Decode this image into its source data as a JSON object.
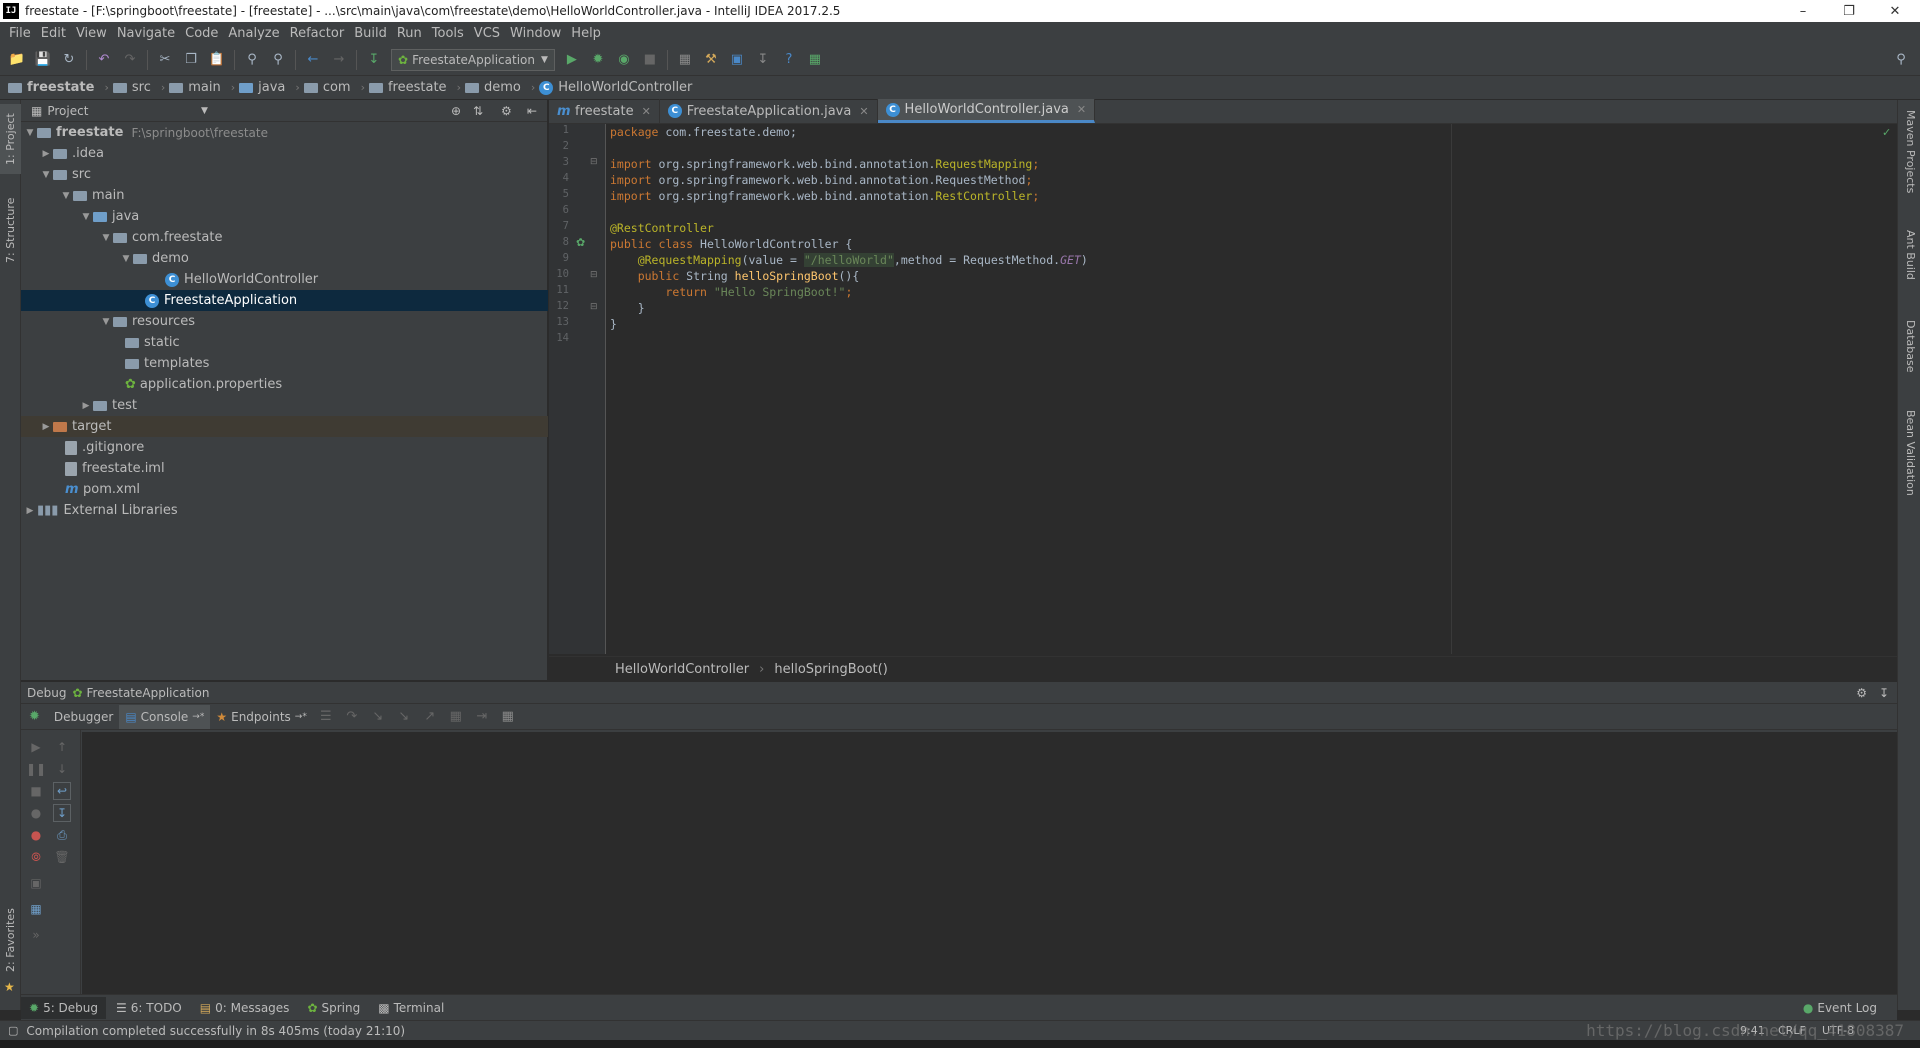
{
  "window": {
    "title": "freestate - [F:\\springboot\\freestate] - [freestate] - ...\\src\\main\\java\\com\\freestate\\demo\\HelloWorldController.java - IntelliJ IDEA 2017.2.5",
    "logo": "IJ"
  },
  "menu": [
    "File",
    "Edit",
    "View",
    "Navigate",
    "Code",
    "Analyze",
    "Refactor",
    "Build",
    "Run",
    "Tools",
    "VCS",
    "Window",
    "Help"
  ],
  "toolbar": {
    "run_config": "FreestateApplication"
  },
  "breadcrumb": [
    "freestate",
    "src",
    "main",
    "java",
    "com",
    "freestate",
    "demo",
    "HelloWorldController"
  ],
  "left_tabs": {
    "project": "1: Project",
    "structure": "7: Structure",
    "favorites": "2: Favorites"
  },
  "right_tabs": {
    "maven": "Maven Projects",
    "ant": "Ant Build",
    "database": "Database",
    "bean": "Bean Validation"
  },
  "project": {
    "header": "Project",
    "root_name": "freestate",
    "root_path": "F:\\springboot\\freestate",
    "nodes": {
      "idea": ".idea",
      "src": "src",
      "main": "main",
      "java": "java",
      "pkg": "com.freestate",
      "demo": "demo",
      "controller": "HelloWorldController",
      "app": "FreestateApplication",
      "resources": "resources",
      "static": "static",
      "templates": "templates",
      "props": "application.properties",
      "test": "test",
      "target": "target",
      "gitignore": ".gitignore",
      "iml": "freestate.iml",
      "pom": "pom.xml",
      "extlib": "External Libraries"
    }
  },
  "editor_tabs": [
    {
      "label": "freestate"
    },
    {
      "label": "FreestateApplication.java"
    },
    {
      "label": "HelloWorldController.java"
    }
  ],
  "code": {
    "line_numbers": [
      "1",
      "2",
      "3",
      "4",
      "5",
      "6",
      "7",
      "8",
      "9",
      "10",
      "11",
      "12",
      "13",
      "14"
    ],
    "l1_kw": "package",
    "l1_rest": " com.freestate.demo;",
    "imp": "import",
    "l3_pkg": " org.springframework.web.bind.annotation.",
    "l3_cls": "RequestMapping",
    "l4_pkg": " org.springframework.web.bind.annotation.",
    "l4_cls": "RequestMethod",
    "l5_pkg": " org.springframework.web.bind.annotation.",
    "l5_cls": "RestController",
    "l7": "@RestController",
    "l8_kw": "public class",
    "l8_rest": " HelloWorldController {",
    "l9_ann": "@RequestMapping",
    "l9_a": "(value = ",
    "l9_str": "\"/helloWorld\"",
    "l9_b": ",method = RequestMethod.",
    "l9_it": "GET",
    "l9_c": ")",
    "l10_kw": "public",
    "l10_a": " String ",
    "l10_fn": "helloSpringBoot",
    "l10_b": "(){",
    "l11_kw": "return",
    "l11_str": "\"Hello SpringBoot!\"",
    "l11_c": ";",
    "l12": "}",
    "l13": "}"
  },
  "editor_breadcrumb": {
    "cls": "HelloWorldController",
    "method": "helloSpringBoot()"
  },
  "debug": {
    "title": "Debug",
    "config": "FreestateApplication",
    "tabs": {
      "debugger": "Debugger",
      "console": "Console",
      "endpoints": "Endpoints"
    }
  },
  "bottom_tabs": {
    "debug": "5: Debug",
    "todo": "6: TODO",
    "messages": "0: Messages",
    "spring": "Spring",
    "terminal": "Terminal",
    "eventlog": "Event Log"
  },
  "status": {
    "message": "Compilation completed successfully in 8s 405ms (today 21:10)",
    "position": "9:41",
    "line_sep": "CRLF",
    "encoding": "UTF-8",
    "watermark": "https://blog.csdn.net/qq_41808387"
  },
  "colors": {
    "accent": "#4a88c7",
    "selection": "#0d293e",
    "run_green": "#59a869"
  }
}
